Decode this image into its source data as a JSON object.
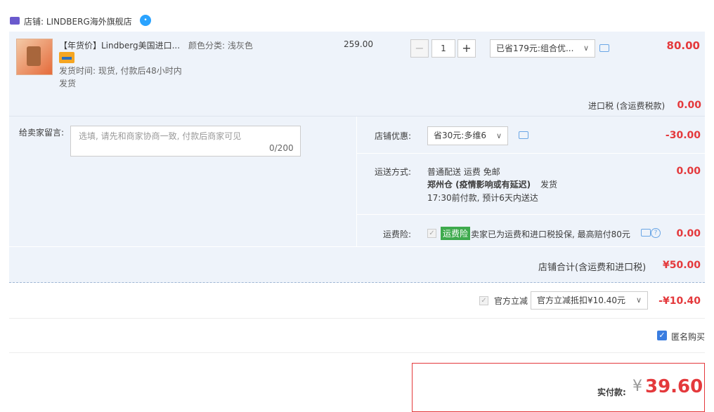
{
  "shop": {
    "label": "店铺: LINDBERG海外旗舰店"
  },
  "item": {
    "title": "【年货价】Lindberg美国进口...",
    "shipping_time": "发货时间: 现货, 付款后48小时内发货",
    "sku": "颜色分类: 浅灰色",
    "price": "259.00",
    "quantity": "1",
    "minus": "−",
    "plus": "+",
    "discount_select": "已省179元:组合优...",
    "subtotal": "80.00",
    "tax_label": "进口税 (含运费税款)",
    "tax_value": "0.00"
  },
  "memo": {
    "label": "给卖家留言:",
    "placeholder": "选填, 请先和商家协商一致, 付款后商家可见",
    "count": "0/200"
  },
  "shop_discount": {
    "label": "店铺优惠:",
    "select": "省30元:多维6",
    "value": "-30.00"
  },
  "delivery": {
    "label": "运送方式:",
    "line1": "普通配送 运费 免邮",
    "warehouse": "郑州仓 (疫情影响或有延迟)",
    "ship_suffix": "发货",
    "line3": "17:30前付款, 预计6天内送达",
    "value": "0.00"
  },
  "insurance": {
    "label": "运费险:",
    "tag": "运费险",
    "text": "卖家已为运费和进口税投保, 最高赔付80元",
    "value": "0.00"
  },
  "shop_total": {
    "label": "店铺合计(含运费和进口税)",
    "value": "¥50.00"
  },
  "official": {
    "label": "官方立减",
    "select": "官方立减抵扣¥10.40元",
    "value": "-¥10.40"
  },
  "anonymous": {
    "label": "匿名购买"
  },
  "pay": {
    "label": "实付款:",
    "currency": "¥",
    "value": "39.60"
  }
}
